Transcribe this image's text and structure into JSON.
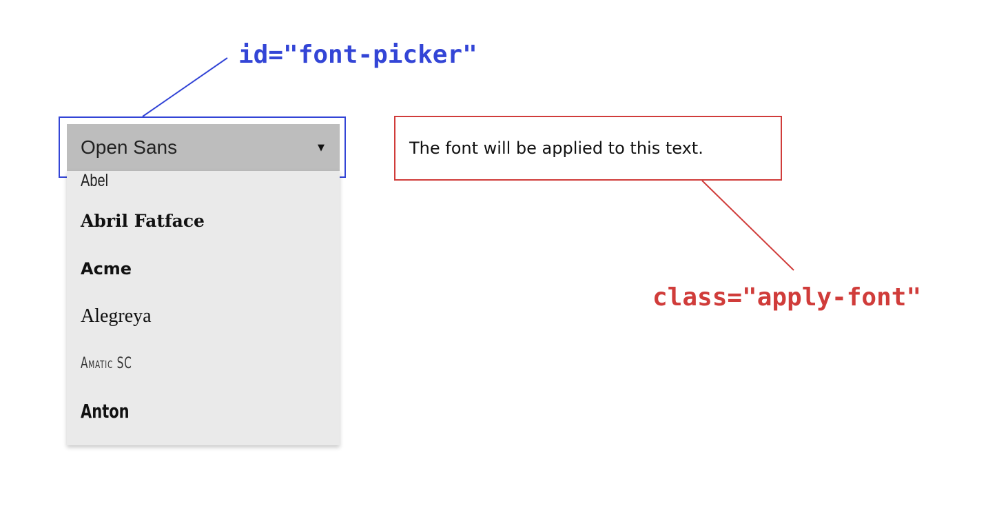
{
  "annotations": {
    "picker_label": "id=\"font-picker\"",
    "apply_label": "class=\"apply-font\"",
    "picker_color": "#3345d6",
    "apply_color": "#d03c3a"
  },
  "font_picker": {
    "active_font": "Open Sans",
    "arrow_icon": "caret-down-icon",
    "options": [
      "Abel",
      "Abril Fatface",
      "Acme",
      "Alegreya",
      "Amatic SC",
      "Anton"
    ]
  },
  "apply_font": {
    "text": "The font will be applied to this text."
  }
}
